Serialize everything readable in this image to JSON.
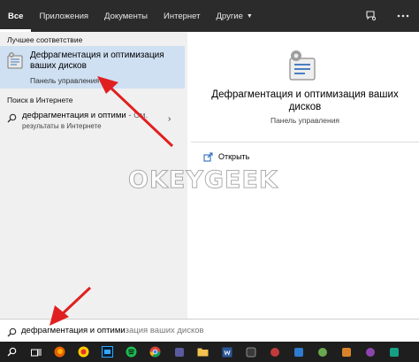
{
  "tabs": [
    {
      "label": "Все",
      "active": true
    },
    {
      "label": "Приложения"
    },
    {
      "label": "Документы"
    },
    {
      "label": "Интернет"
    },
    {
      "label": "Другие"
    }
  ],
  "left": {
    "best_match_heading": "Лучшее соответствие",
    "best_match": {
      "title": "Дефрагментация и оптимизация ваших дисков",
      "subtitle": "Панель управления",
      "icon": "defrag-control-panel-icon"
    },
    "web_heading": "Поиск в Интернете",
    "web_result": {
      "query_bold": "дефрагментация и оптими",
      "query_rest": "- См.",
      "subtitle": "результаты в Интернете"
    }
  },
  "right": {
    "title": "Дефрагментация и оптимизация ваших дисков",
    "subtitle": "Панель управления",
    "actions": [
      {
        "label": "Открыть",
        "icon": "open-icon"
      }
    ]
  },
  "watermark": "OKEYGEEK",
  "search": {
    "typed": "дефрагментация и оптими",
    "suggestion": "зация ваших дисков"
  },
  "colors": {
    "topbar_bg": "#2b2b2b",
    "left_bg": "#f0f0f0",
    "selection_bg": "#cfe0f3",
    "annotation_arrow": "#e02020",
    "taskbar_bg": "#1e1e1e"
  },
  "taskbar_icons": [
    "start-icon",
    "task-view-icon",
    "firefox-icon",
    "yandex-icon",
    "photoshop-icon",
    "spotify-icon",
    "chrome-icon",
    "app-icon",
    "file-explorer-icon",
    "word-icon",
    "app-icon",
    "app-icon",
    "app-icon",
    "app-icon",
    "app-icon",
    "app-icon",
    "app-icon"
  ]
}
